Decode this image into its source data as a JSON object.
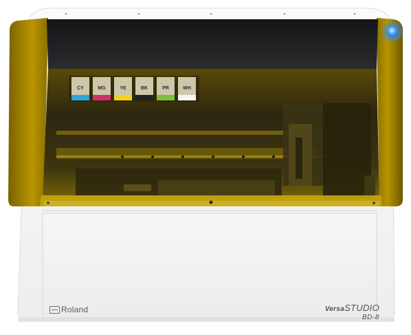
{
  "image": {
    "subject": "desktop UV printer, front view",
    "colors": {
      "body": "#f4f4f3",
      "lid_tint": "#c9a70b",
      "lid_dark": "#1c1d1f",
      "side_panel": "#b89500",
      "power_led": "#2f8fff",
      "logo_text": "#55585c"
    }
  },
  "branding": {
    "maker": "Roland",
    "series_prefix": "Versa",
    "series_name": "STUDIO",
    "model": "BD-8"
  },
  "ink_cartridges": [
    {
      "label": "CY",
      "color": "#2aa6d8"
    },
    {
      "label": "MG",
      "color": "#d0306e"
    },
    {
      "label": "YE",
      "color": "#f2d21a"
    },
    {
      "label": "BK",
      "color": "#222222"
    },
    {
      "label": "PR",
      "color": "#7fbf3f"
    },
    {
      "label": "WH",
      "color": "#f5f5f5"
    }
  ]
}
